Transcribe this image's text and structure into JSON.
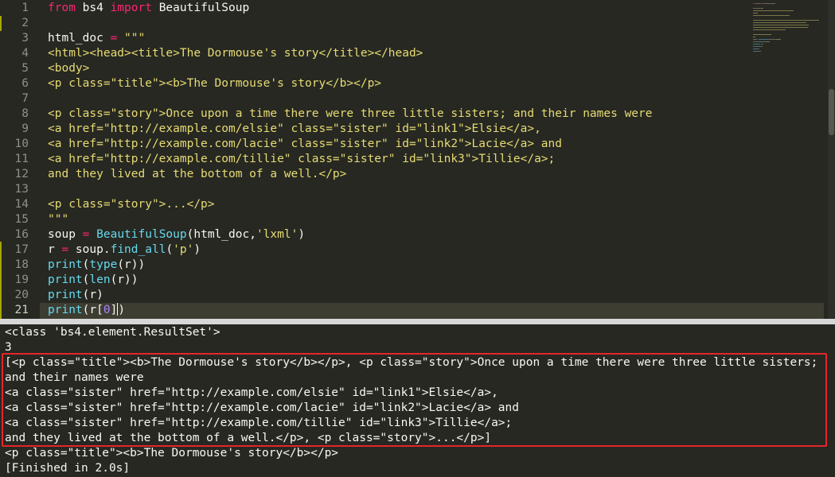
{
  "editor": {
    "line_numbers": [
      "1",
      "2",
      "3",
      "4",
      "5",
      "6",
      "7",
      "8",
      "9",
      "10",
      "11",
      "12",
      "13",
      "14",
      "15",
      "16",
      "17",
      "18",
      "19",
      "20",
      "21"
    ],
    "lines": [
      [
        {
          "t": "from",
          "c": "kw"
        },
        {
          "t": " bs4 ",
          "c": ""
        },
        {
          "t": "import",
          "c": "kw"
        },
        {
          "t": " BeautifulSoup",
          "c": ""
        }
      ],
      [],
      [
        {
          "t": "html_doc ",
          "c": ""
        },
        {
          "t": "=",
          "c": "kw"
        },
        {
          "t": " ",
          "c": ""
        },
        {
          "t": "\"\"\"",
          "c": "st"
        }
      ],
      [
        {
          "t": "<html><head><title>The Dormouse's story</title></head>",
          "c": "st"
        }
      ],
      [
        {
          "t": "<body>",
          "c": "st"
        }
      ],
      [
        {
          "t": "<p class=\"title\"><b>The Dormouse's story</b></p>",
          "c": "st"
        }
      ],
      [],
      [
        {
          "t": "<p class=\"story\">Once upon a time there were three little sisters; and their names were",
          "c": "st"
        }
      ],
      [
        {
          "t": "<a href=\"http://example.com/elsie\" class=\"sister\" id=\"link1\">Elsie</a>,",
          "c": "st"
        }
      ],
      [
        {
          "t": "<a href=\"http://example.com/lacie\" class=\"sister\" id=\"link2\">Lacie</a> and",
          "c": "st"
        }
      ],
      [
        {
          "t": "<a href=\"http://example.com/tillie\" class=\"sister\" id=\"link3\">Tillie</a>;",
          "c": "st"
        }
      ],
      [
        {
          "t": "and they lived at the bottom of a well.</p>",
          "c": "st"
        }
      ],
      [],
      [
        {
          "t": "<p class=\"story\">...</p>",
          "c": "st"
        }
      ],
      [
        {
          "t": "\"\"\"",
          "c": "st"
        }
      ],
      [
        {
          "t": "soup ",
          "c": ""
        },
        {
          "t": "=",
          "c": "kw"
        },
        {
          "t": " ",
          "c": ""
        },
        {
          "t": "BeautifulSoup",
          "c": "fn"
        },
        {
          "t": "(html_doc,",
          "c": ""
        },
        {
          "t": "'lxml'",
          "c": "st"
        },
        {
          "t": ")",
          "c": ""
        }
      ],
      [
        {
          "t": "r ",
          "c": ""
        },
        {
          "t": "=",
          "c": "kw"
        },
        {
          "t": " soup.",
          "c": ""
        },
        {
          "t": "find_all",
          "c": "fn"
        },
        {
          "t": "(",
          "c": ""
        },
        {
          "t": "'p'",
          "c": "st"
        },
        {
          "t": ")",
          "c": ""
        }
      ],
      [
        {
          "t": "print",
          "c": "fn"
        },
        {
          "t": "(",
          "c": ""
        },
        {
          "t": "type",
          "c": "fn"
        },
        {
          "t": "(r))",
          "c": ""
        }
      ],
      [
        {
          "t": "print",
          "c": "fn"
        },
        {
          "t": "(",
          "c": ""
        },
        {
          "t": "len",
          "c": "fn"
        },
        {
          "t": "(r))",
          "c": ""
        }
      ],
      [
        {
          "t": "print",
          "c": "fn"
        },
        {
          "t": "(r)",
          "c": ""
        }
      ],
      [
        {
          "t": "print",
          "c": "fn"
        },
        {
          "t": "(r[",
          "c": ""
        },
        {
          "t": "0",
          "c": "nm"
        },
        {
          "t": "])",
          "c": ""
        }
      ]
    ]
  },
  "output": {
    "lines": [
      "<class 'bs4.element.ResultSet'>",
      "3",
      "[<p class=\"title\"><b>The Dormouse's story</b></p>, <p class=\"story\">Once upon a time there were three little sisters;",
      "and their names were",
      "<a class=\"sister\" href=\"http://example.com/elsie\" id=\"link1\">Elsie</a>,",
      "<a class=\"sister\" href=\"http://example.com/lacie\" id=\"link2\">Lacie</a> and",
      "<a class=\"sister\" href=\"http://example.com/tillie\" id=\"link3\">Tillie</a>;",
      "and they lived at the bottom of a well.</p>, <p class=\"story\">...</p>]",
      "<p class=\"title\"><b>The Dormouse's story</b></p>",
      "[Finished in 2.0s]"
    ]
  },
  "colors": {
    "background": "#272822",
    "keyword": "#f92672",
    "string": "#e6db74",
    "function": "#66d9ef",
    "number": "#ae81ff",
    "highlight_box": "#e4262a"
  }
}
